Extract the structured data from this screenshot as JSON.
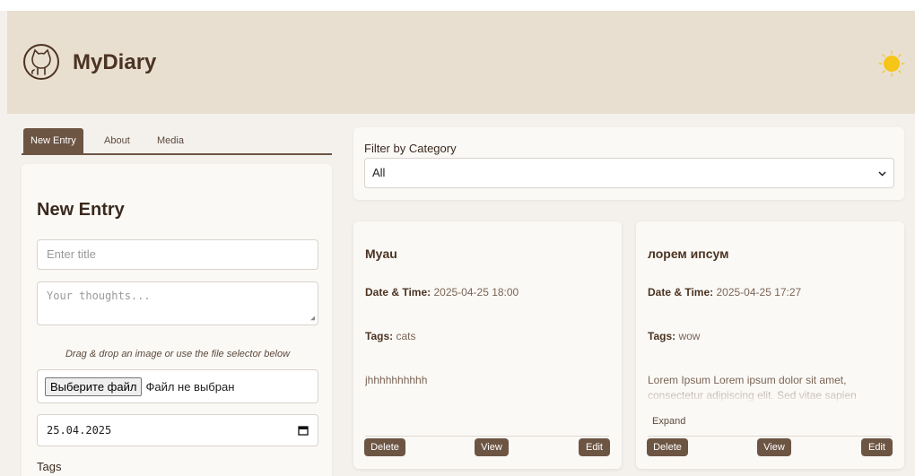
{
  "app": {
    "brand": "MyDiary"
  },
  "tabs": [
    {
      "label": "New Entry",
      "active": true
    },
    {
      "label": "About",
      "active": false
    },
    {
      "label": "Media",
      "active": false
    }
  ],
  "form": {
    "title": "New Entry",
    "title_placeholder": "Enter title",
    "thoughts_placeholder": "Your thoughts...",
    "drop_hint": "Drag & drop an image or use the file selector below",
    "file_button": "Выберите файл",
    "file_status": "Файл не выбран",
    "date_value": "25.04.2025",
    "tags_label": "Tags"
  },
  "filter": {
    "label": "Filter by Category",
    "selected": "All"
  },
  "entries": [
    {
      "title": "Myau",
      "date_label": "Date & Time:",
      "date_value": "2025-04-25 18:00",
      "tags_label": "Tags:",
      "tags_value": "cats",
      "body": "jhhhhhhhhhh",
      "expand": "",
      "delete": "Delete",
      "view": "View",
      "edit": "Edit"
    },
    {
      "title": "лорем ипсум",
      "date_label": "Date & Time:",
      "date_value": "2025-04-25 17:27",
      "tags_label": "Tags:",
      "tags_value": "wow",
      "body": "Lorem Ipsum Lorem ipsum dolor sit amet, consectetur adipiscing elit. Sed vitae sapien",
      "expand": "Expand",
      "delete": "Delete",
      "view": "View",
      "edit": "Edit"
    }
  ],
  "colors": {
    "header_bg": "#e9dfd0",
    "accent": "#6d5544",
    "sun": "#f5c518"
  },
  "icons": {
    "logo": "github-cat-icon",
    "theme": "sun-icon",
    "calendar": "calendar-icon",
    "select": "chevron-down-icon"
  }
}
